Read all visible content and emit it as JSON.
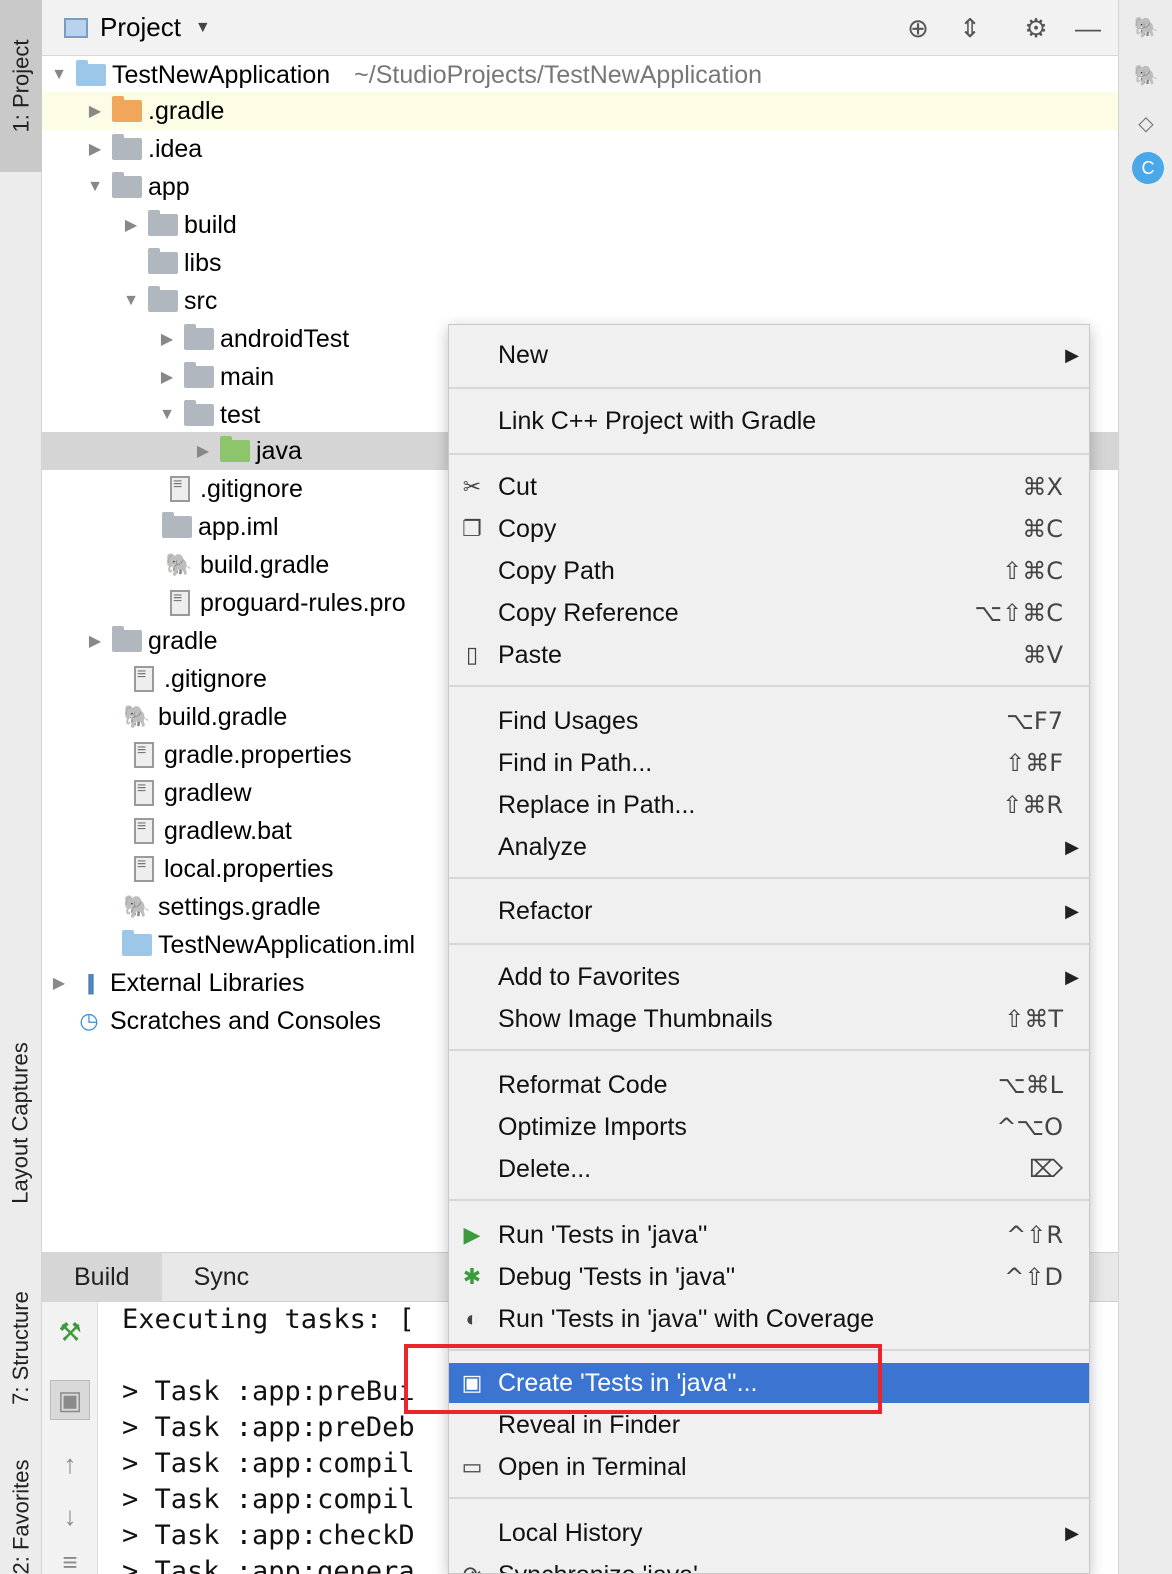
{
  "left_strip": {
    "project_tab": "1: Project",
    "layout_captures_tab": "Layout Captures",
    "structure_tab": "7: Structure",
    "favorites_tab": "2: Favorites"
  },
  "project_panel": {
    "title": "Project",
    "dropdown_icon": "chevron-down-icon",
    "tree": [
      {
        "label": "TestNewApplication",
        "path": "~/StudioProjects/TestNewApplication"
      },
      {
        "label": ".gradle"
      },
      {
        "label": ".idea"
      },
      {
        "label": "app"
      },
      {
        "label": "build"
      },
      {
        "label": "libs"
      },
      {
        "label": "src"
      },
      {
        "label": "androidTest"
      },
      {
        "label": "main"
      },
      {
        "label": "test"
      },
      {
        "label": "java"
      },
      {
        "label": ".gitignore"
      },
      {
        "label": "app.iml"
      },
      {
        "label": "build.gradle"
      },
      {
        "label": "proguard-rules.pro"
      },
      {
        "label": "gradle"
      },
      {
        "label": ".gitignore"
      },
      {
        "label": "build.gradle"
      },
      {
        "label": "gradle.properties"
      },
      {
        "label": "gradlew"
      },
      {
        "label": "gradlew.bat"
      },
      {
        "label": "local.properties"
      },
      {
        "label": "settings.gradle"
      },
      {
        "label": "TestNewApplication.iml"
      },
      {
        "label": "External Libraries"
      },
      {
        "label": "Scratches and Consoles"
      }
    ]
  },
  "build_panel": {
    "tabs": [
      "Build",
      "Sync"
    ],
    "console": [
      "Executing tasks: [",
      "> Task :app:preBui",
      "> Task :app:preDeb",
      "> Task :app:compil",
      "> Task :app:compil",
      "> Task :app:checkD",
      "> Task :app:genera"
    ]
  },
  "context_menu": {
    "items": [
      {
        "label": "New",
        "submenu": true
      },
      {
        "label": "Link C++ Project with Gradle"
      },
      {
        "label": "Cut",
        "shortcut": "⌘X",
        "icon": "scissors-icon"
      },
      {
        "label": "Copy",
        "shortcut": "⌘C",
        "icon": "copy-icon"
      },
      {
        "label": "Copy Path",
        "shortcut": "⇧⌘C"
      },
      {
        "label": "Copy Reference",
        "shortcut": "⌥⇧⌘C"
      },
      {
        "label": "Paste",
        "shortcut": "⌘V",
        "icon": "clipboard-icon"
      },
      {
        "label": "Find Usages",
        "shortcut": "⌥F7"
      },
      {
        "label": "Find in Path...",
        "shortcut": "⇧⌘F"
      },
      {
        "label": "Replace in Path...",
        "shortcut": "⇧⌘R"
      },
      {
        "label": "Analyze",
        "submenu": true
      },
      {
        "label": "Refactor",
        "submenu": true
      },
      {
        "label": "Add to Favorites",
        "submenu": true
      },
      {
        "label": "Show Image Thumbnails",
        "shortcut": "⇧⌘T"
      },
      {
        "label": "Reformat Code",
        "shortcut": "⌥⌘L"
      },
      {
        "label": "Optimize Imports",
        "shortcut": "^⌥O"
      },
      {
        "label": "Delete...",
        "shortcut": "⌦"
      },
      {
        "label": "Run 'Tests in 'java''",
        "shortcut": "^⇧R",
        "icon": "run-icon"
      },
      {
        "label": "Debug 'Tests in 'java''",
        "shortcut": "^⇧D",
        "icon": "debug-icon"
      },
      {
        "label": "Run 'Tests in 'java'' with Coverage",
        "icon": "coverage-icon"
      },
      {
        "label": "Create 'Tests in 'java''...",
        "icon": "create-test-icon",
        "selected": true
      },
      {
        "label": "Reveal in Finder"
      },
      {
        "label": "Open in Terminal",
        "icon": "terminal-icon"
      },
      {
        "label": "Local History",
        "submenu": true
      },
      {
        "label": "Synchronize 'java'"
      }
    ]
  },
  "colors": {
    "selection": "#3b74d1",
    "highlight_box": "#e8262b",
    "tree_selected_row": "#d5d5d5"
  }
}
